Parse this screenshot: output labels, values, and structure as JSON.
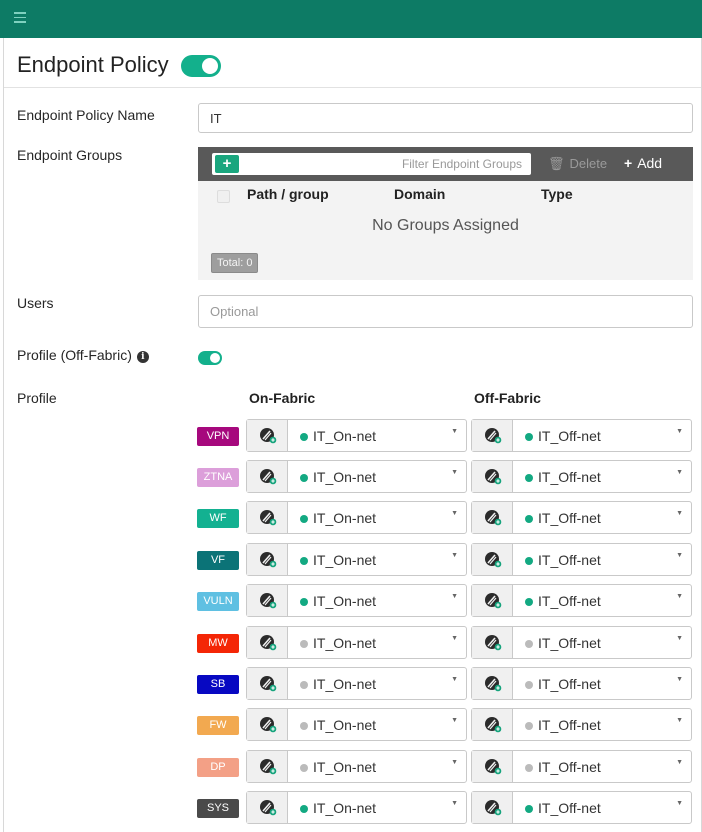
{
  "title": "Endpoint Policy",
  "fields": {
    "name_label": "Endpoint Policy Name",
    "name_value": "IT",
    "groups_label": "Endpoint Groups",
    "users_label": "Users",
    "users_placeholder": "Optional",
    "profile_offfabric_label": "Profile (Off-Fabric)",
    "profile_label": "Profile"
  },
  "groups": {
    "filter_placeholder": "Filter Endpoint Groups",
    "delete_label": "Delete",
    "add_label": "Add",
    "columns": [
      "Path / group",
      "Domain",
      "Type"
    ],
    "empty_text": "No Groups Assigned",
    "total_label": "Total: 0"
  },
  "columns": {
    "on_fabric": "On-Fabric",
    "off_fabric": "Off-Fabric"
  },
  "colors": {
    "topbar": "#0d7b65",
    "toggle": "#13b08c",
    "dot_active": "#13a982",
    "dot_inactive": "#bbbbbb"
  },
  "profiles": [
    {
      "tag": "VPN",
      "color": "#a6087d",
      "on": "IT_On-net",
      "off": "IT_Off-net",
      "active": true
    },
    {
      "tag": "ZTNA",
      "color": "#dc9fda",
      "on": "IT_On-net",
      "off": "IT_Off-net",
      "active": true
    },
    {
      "tag": "WF",
      "color": "#13b191",
      "on": "IT_On-net",
      "off": "IT_Off-net",
      "active": true
    },
    {
      "tag": "VF",
      "color": "#0b7377",
      "on": "IT_On-net",
      "off": "IT_Off-net",
      "active": true
    },
    {
      "tag": "VULN",
      "color": "#5fc0e2",
      "on": "IT_On-net",
      "off": "IT_Off-net",
      "active": true
    },
    {
      "tag": "MW",
      "color": "#f42606",
      "on": "IT_On-net",
      "off": "IT_Off-net",
      "active": false
    },
    {
      "tag": "SB",
      "color": "#0708c2",
      "on": "IT_On-net",
      "off": "IT_Off-net",
      "active": false
    },
    {
      "tag": "FW",
      "color": "#f2a950",
      "on": "IT_On-net",
      "off": "IT_Off-net",
      "active": false
    },
    {
      "tag": "DP",
      "color": "#f3a086",
      "on": "IT_On-net",
      "off": "IT_Off-net",
      "active": false
    },
    {
      "tag": "SYS",
      "color": "#4a4a4a",
      "on": "IT_On-net",
      "off": "IT_Off-net",
      "active": true
    }
  ]
}
